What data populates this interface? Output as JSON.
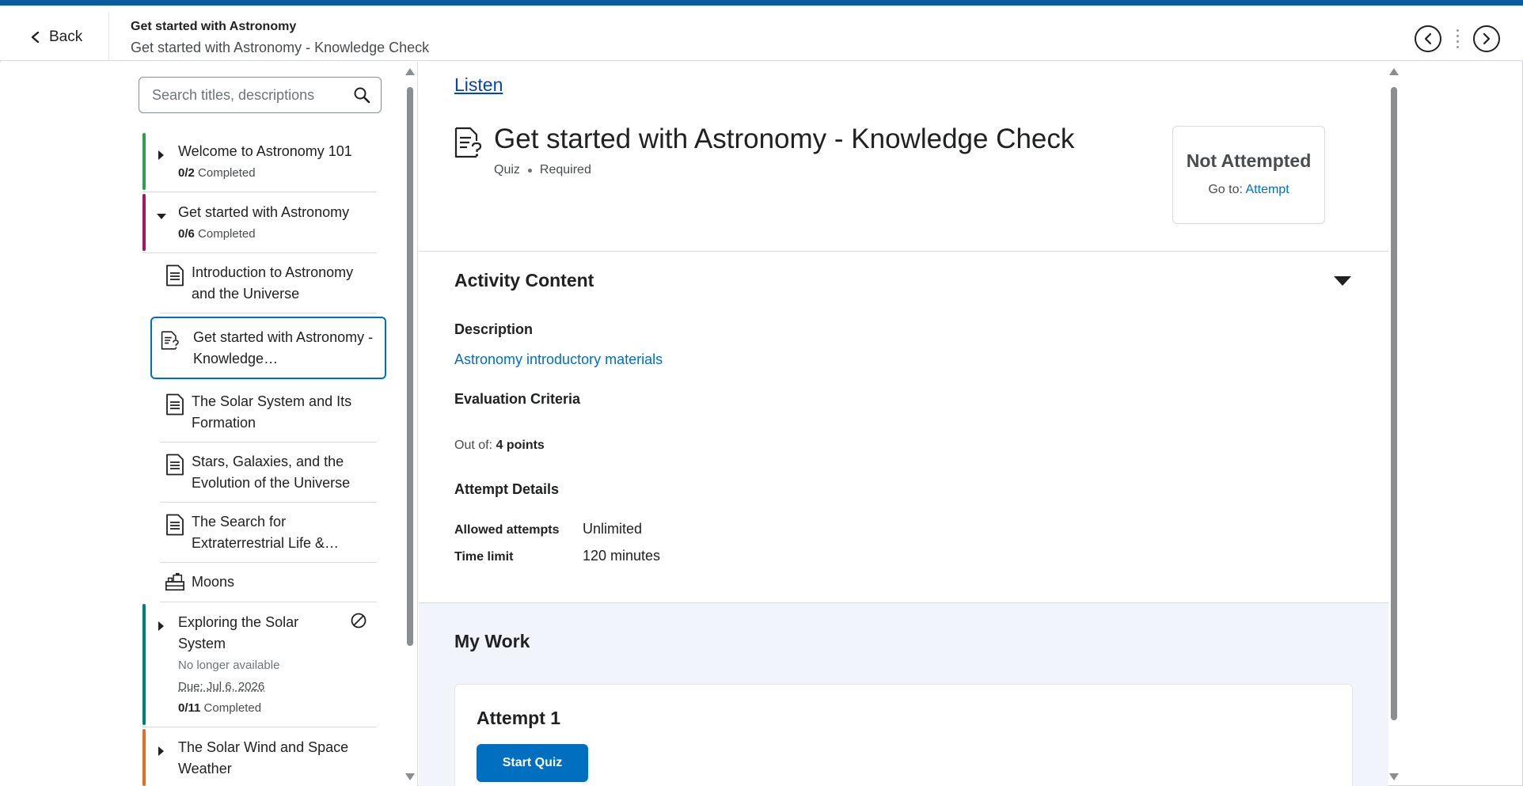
{
  "header": {
    "back_label": "Back",
    "breadcrumb_parent": "Get started with Astronomy",
    "breadcrumb_current": "Get started with Astronomy - Knowledge Check"
  },
  "sidebar": {
    "search_placeholder": "Search titles, descriptions",
    "units": [
      {
        "title": "Welcome to Astronomy 101",
        "progress_count": "0/2",
        "progress_label": "Completed",
        "color": "#2e9e4f"
      },
      {
        "title": "Get started with Astronomy",
        "progress_count": "0/6",
        "progress_label": "Completed",
        "color": "#a5175f"
      },
      {
        "title": "Exploring the Solar System",
        "availability": "No longer available",
        "due": "Due: Jul 6, 2026",
        "progress_count": "0/11",
        "progress_label": "Completed",
        "color": "#007f7a"
      },
      {
        "title": "The Solar Wind and Space Weather",
        "color": "#e26f25"
      }
    ],
    "topics": [
      {
        "title": "Introduction to Astronomy and the Universe",
        "icon": "document-icon"
      },
      {
        "title": "Get started with Astronomy - Knowledge…",
        "icon": "quiz-icon"
      },
      {
        "title": "The Solar System and Its Formation",
        "icon": "document-icon"
      },
      {
        "title": "Stars, Galaxies, and the Evolution of the Universe",
        "icon": "document-icon"
      },
      {
        "title": "The Search for Extraterrestrial Life &…",
        "icon": "document-icon"
      },
      {
        "title": "Moons",
        "icon": "lego-block-icon"
      }
    ]
  },
  "main": {
    "listen_label": "Listen",
    "title": "Get started with Astronomy - Knowledge Check",
    "type": "Quiz",
    "requirement": "Required",
    "status": {
      "title": "Not Attempted",
      "goto_prefix": "Go to:",
      "goto_link": "Attempt"
    },
    "activity_content": {
      "title": "Activity Content",
      "description_label": "Description",
      "description_link": "Astronomy introductory materials",
      "evaluation_label": "Evaluation Criteria",
      "out_of_prefix": "Out of:",
      "out_of_value": "4 points",
      "attempt_details_label": "Attempt Details",
      "allowed_attempts_key": "Allowed attempts",
      "allowed_attempts_value": "Unlimited",
      "time_limit_key": "Time limit",
      "time_limit_value": "120 minutes"
    },
    "my_work": {
      "title": "My Work",
      "attempt_title": "Attempt 1",
      "start_label": "Start Quiz"
    }
  },
  "colors": {
    "accent": "#006fbf",
    "top_bar": "#0a5e9e",
    "link": "#0645ad"
  }
}
